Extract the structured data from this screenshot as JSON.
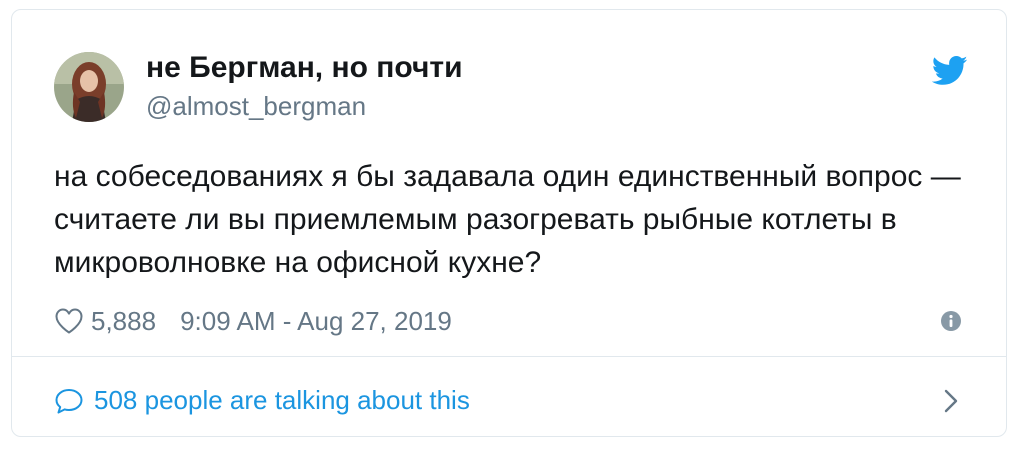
{
  "tweet": {
    "display_name": "не Бергман, но почти",
    "handle": "@almost_bergman",
    "text": "на собеседованиях я бы задавала один единственный вопрос — считаете ли вы приемлемым разогревать рыбные котлеты в микроволновке на офисной кухне?",
    "like_count": "5,888",
    "timestamp": "9:09 AM - Aug 27, 2019"
  },
  "conversation": {
    "label": "508 people are talking about this"
  },
  "icons": {
    "brand": "twitter-bird-icon",
    "like": "heart-icon",
    "info": "info-icon",
    "reply": "speech-bubble-icon",
    "expand": "chevron-right-icon"
  },
  "colors": {
    "twitter_blue": "#1da1f2",
    "link_blue": "#1b95e0",
    "secondary_text": "#657786",
    "primary_text": "#14171a",
    "border": "#e1e8ed"
  }
}
